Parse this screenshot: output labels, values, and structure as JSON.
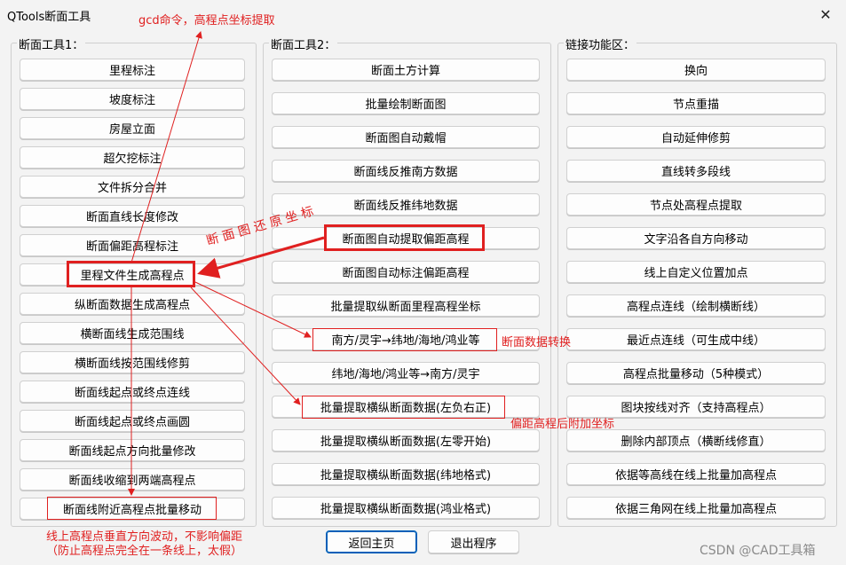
{
  "window": {
    "title": "QTools断面工具"
  },
  "groups": [
    {
      "title": "断面工具1："
    },
    {
      "title": "断面工具2："
    },
    {
      "title": "链接功能区："
    }
  ],
  "col1": [
    "里程标注",
    "坡度标注",
    "房屋立面",
    "超欠挖标注",
    "文件拆分合并",
    "断面直线长度修改",
    "断面偏距高程标注",
    "里程文件生成高程点",
    "纵断面数据生成高程点",
    "横断面线生成范围线",
    "横断面线按范围线修剪",
    "断面线起点或终点连线",
    "断面线起点或终点画圆",
    "断面线起点方向批量修改",
    "断面线收缩到两端高程点",
    "断面线附近高程点批量移动"
  ],
  "col2": [
    "断面土方计算",
    "批量绘制断面图",
    "断面图自动戴帽",
    "断面线反推南方数据",
    "断面线反推纬地数据",
    "断面图自动提取偏距高程",
    "断面图自动标注偏距高程",
    "批量提取纵断面里程高程坐标",
    "南方/灵宇→纬地/海地/鸿业等",
    "纬地/海地/鸿业等→南方/灵宇",
    "批量提取横纵断面数据(左负右正)",
    "批量提取横纵断面数据(左零开始)",
    "批量提取横纵断面数据(纬地格式)",
    "批量提取横纵断面数据(鸿业格式)"
  ],
  "col3": [
    "换向",
    "节点重描",
    "自动延伸修剪",
    "直线转多段线",
    "节点处高程点提取",
    "文字沿各自方向移动",
    "线上自定义位置加点",
    "高程点连线（绘制横断线）",
    "最近点连线（可生成中线）",
    "高程点批量移动（5种模式）",
    "图块按线对齐（支持高程点）",
    "删除内部顶点（横断线修直）",
    "依据等高线在线上批量加高程点",
    "依据三角网在线上批量加高程点"
  ],
  "bottom": {
    "home": "返回主页",
    "exit": "退出程序"
  },
  "annotations": {
    "top": "gcd命令，高程点坐标提取",
    "diagonal": "断 面 图 还 原 坐 标",
    "convert": "断面数据转换",
    "offset": "偏距高程后附加坐标",
    "bottom1": "线上高程点垂直方向波动，不影响偏距",
    "bottom2": "（防止高程点完全在一条线上，太假）"
  },
  "watermark": "CSDN @CAD工具箱",
  "colors": {
    "annotation": "#e02020",
    "accent": "#005fb8"
  }
}
